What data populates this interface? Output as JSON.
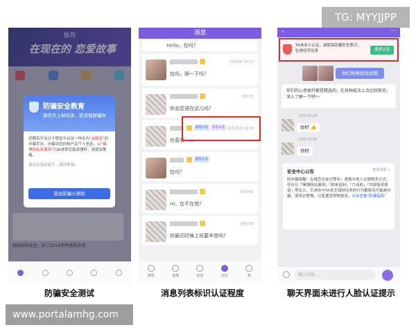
{
  "watermark": "TG: MYYJJPP",
  "site_label": "www.portalamhg.com",
  "captions": [
    "防骗安全测试",
    "消息列表标识认证程度",
    "聊天界面未进行人脸认证提示"
  ],
  "phone1": {
    "tab_title": "推荐",
    "banner": "在现在的 恋爱故事",
    "modal": {
      "title": "防骗安全教育",
      "subtitle": "莫信天上掉馅饼，投资理财骗你",
      "body_1": "近期有不法分子假冒平台及一种名为",
      "body_hl1": "\"余额宝\"",
      "body_2": "的诈骗手法，诈骗到您的账户及个人信息，以",
      "body_hl2": "\"赌博网站有漏洞\"",
      "body_3": "为由诱导您投资理财，请提高警惕。",
      "footnote": "请在安全前提下，保持警惕。",
      "button": "前往防骗小测验"
    },
    "news_text": "刚出炉的女生，扒了2019年所有的女孩"
  },
  "phone2": {
    "header": "消息",
    "greeting": "Hello，在吗？",
    "rows": [
      {
        "time": "2月20日 20:17",
        "text": "在吗，聊一下吗？"
      },
      {
        "time": "9月1日",
        "text": "你会您诺在这儿吗？"
      },
      {
        "time": "10月25日 02:58",
        "text": "你喜欢一..."
      },
      {
        "time": "",
        "text": "在吗？"
      },
      {
        "time": "9月24日",
        "text": "Hi，在不在啦？"
      },
      {
        "time": "9月19日",
        "text": "你最近时候上班要辛苦吗？"
      }
    ],
    "badge_face": "面容认证",
    "badge_real": "实名认证",
    "nav": [
      "推荐",
      "直播",
      "动态",
      "消息",
      "我"
    ]
  },
  "phone3": {
    "alert_text": "TA未本人认证，请提高防骗安全意识，牡绝经济往来",
    "alert_button": "请求认证",
    "topic_button": "你们性格很合适哦",
    "card_text": "你们的心思很齐都是精选的，在各种层次上合比较契合，深入了解一下吧～",
    "time1": "22日 14:28",
    "reply1": "你好 👍",
    "time2": "22日 14:30",
    "reply2": "你好",
    "notice_title": "安全中心公告",
    "notice_detail": "查看详情 >",
    "notice_body": "防诈骗提醒：在婚恋交友过程中，谨慎与他人交换联系方式，任何以「赌博网站漏洞」「刷单返利」「六合彩」「内部投资渠道」等名义，引诱你与TA发生钱财往来的行为都极有可能是诈骗，请务必警惕，以免遭受财物损失。",
    "notice_link": "点击查看\"防骗指南\"",
    "input_placeholder": "输入内容..."
  }
}
